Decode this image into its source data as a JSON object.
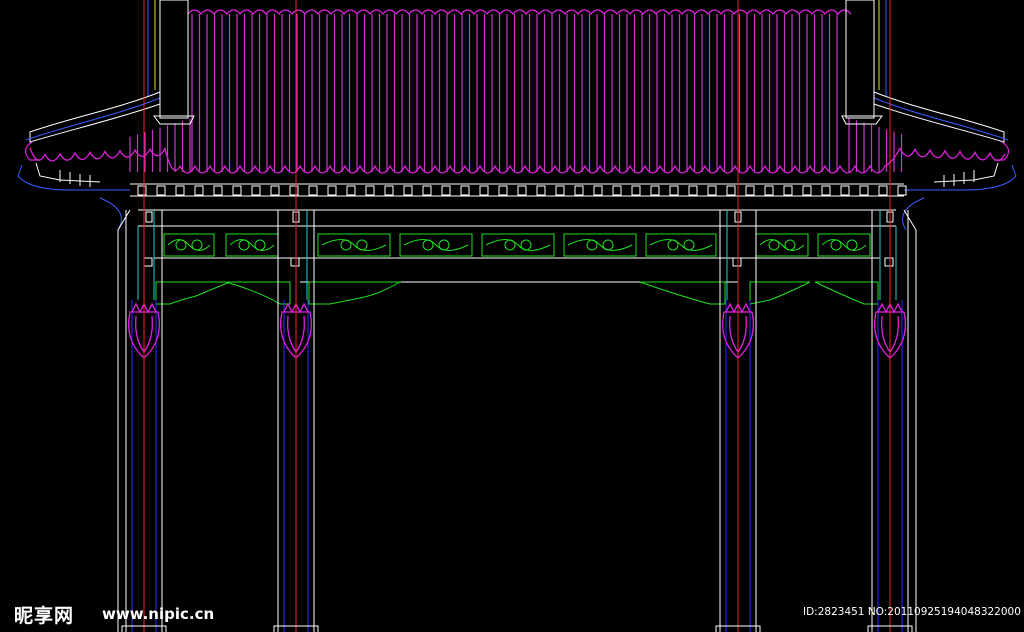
{
  "drawing": {
    "subject": "chinese-pavilion-elevation-cad",
    "colors": {
      "background": "#000000",
      "roof_tiles": "#d43ad4",
      "roof_outline": "#e020e0",
      "axis": "#ff2020",
      "column_outline": "#2a2aff",
      "frame": "#ffffff",
      "carving": "#20e020",
      "cyan_detail": "#20d0d0",
      "eave_blue": "#3b5bff",
      "yellow_detail": "#e0e020"
    }
  },
  "watermark": {
    "logo_text": "昵享网",
    "url_text": "www.nipic.cn",
    "id_text": "ID:2823451 NO:20110925194048322000"
  }
}
